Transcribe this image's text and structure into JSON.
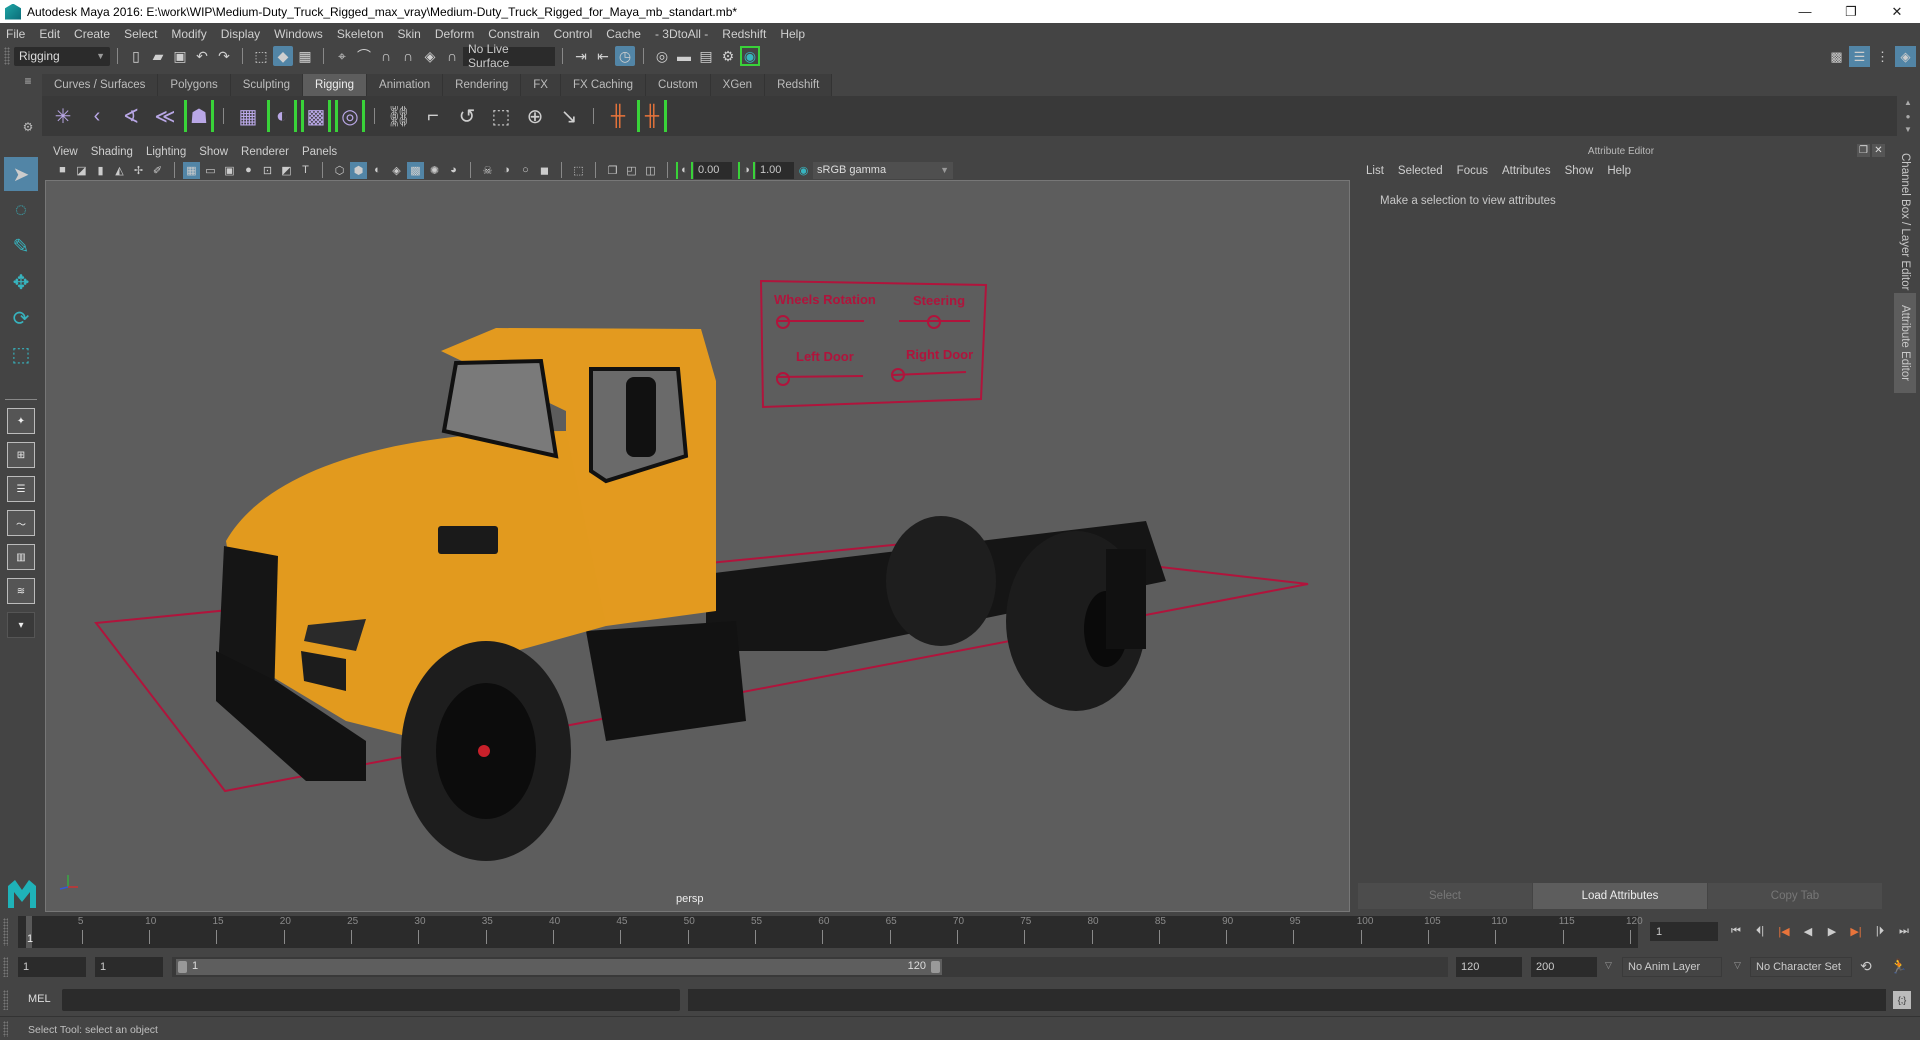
{
  "window": {
    "title": "Autodesk Maya 2016: E:\\work\\WIP\\Medium-Duty_Truck_Rigged_max_vray\\Medium-Duty_Truck_Rigged_for_Maya_mb_standart.mb*",
    "minimize": "—",
    "restore": "❐",
    "close": "✕"
  },
  "menu": [
    "File",
    "Edit",
    "Create",
    "Select",
    "Modify",
    "Display",
    "Windows",
    "Skeleton",
    "Skin",
    "Deform",
    "Constrain",
    "Control",
    "Cache",
    "- 3DtoAll -",
    "Redshift",
    "Help"
  ],
  "statusline": {
    "menuset": "Rigging",
    "live_surface": "No Live Surface"
  },
  "shelf": {
    "tabs": [
      "Curves / Surfaces",
      "Polygons",
      "Sculpting",
      "Rigging",
      "Animation",
      "Rendering",
      "FX",
      "FX Caching",
      "Custom",
      "XGen",
      "Redshift"
    ],
    "active_tab": "Rigging"
  },
  "panel": {
    "menus": [
      "View",
      "Shading",
      "Lighting",
      "Show",
      "Renderer",
      "Panels"
    ],
    "exposure": "0.00",
    "gamma": "1.00",
    "color_space": "sRGB gamma",
    "camera": "persp"
  },
  "rig_controls": {
    "labels": [
      "Wheels Rotation",
      "Steering",
      "Left Door",
      "Right Door"
    ],
    "color": "#b0143c"
  },
  "attribute_editor": {
    "title": "Attribute Editor",
    "menus": [
      "List",
      "Selected",
      "Focus",
      "Attributes",
      "Show",
      "Help"
    ],
    "message": "Make a selection to view attributes",
    "buttons": [
      {
        "label": "Select",
        "enabled": false
      },
      {
        "label": "Load Attributes",
        "enabled": true
      },
      {
        "label": "Copy Tab",
        "enabled": false
      }
    ]
  },
  "side_tabs": [
    "Channel Box / Layer Editor",
    "Attribute Editor"
  ],
  "timeline": {
    "ticks": [
      5,
      10,
      15,
      20,
      25,
      30,
      35,
      40,
      45,
      50,
      55,
      60,
      65,
      70,
      75,
      80,
      85,
      90,
      95,
      100,
      105,
      110,
      115,
      120
    ],
    "start": 1,
    "end": 120,
    "current_frame": "1",
    "current_frame_field": "1"
  },
  "range": {
    "anim_start": "1",
    "playback_start": "1",
    "slider_start": "1",
    "slider_end": "120",
    "playback_end": "120",
    "anim_end": "200",
    "anim_layer": "No Anim Layer",
    "character_set": "No Character Set"
  },
  "command_line": {
    "language": "MEL"
  },
  "help_line": "Select Tool: select an object",
  "colors": {
    "accent": "#5285a6",
    "highlight_green": "#39d239",
    "truck_body": "#e29a1e",
    "rig_red": "#b0143c"
  }
}
